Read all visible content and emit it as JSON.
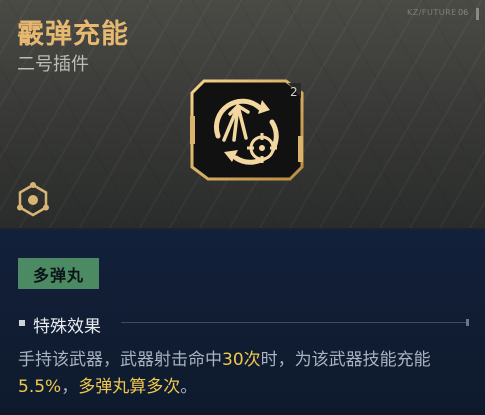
{
  "item": {
    "name": "霰弹充能",
    "type": "二号插件",
    "corner_tag": "KZ/FUTURE",
    "corner_num": "06",
    "level_badge": "2",
    "icon": "shotgun-charge-icon",
    "set_icon": "hexagon-node-icon"
  },
  "set_badge": "多弹丸",
  "effect": {
    "title": "特殊效果",
    "parts": [
      "手持该武器，武器射击命中",
      "30次",
      "时，为该武器技能充能",
      "5.5%",
      "，",
      "多弹丸算多次",
      "。"
    ]
  },
  "colors": {
    "title_gold": "#e6b870",
    "highlight": "#f0c850",
    "badge_green": "#4b8a63",
    "panel_bg": "#13203a"
  }
}
